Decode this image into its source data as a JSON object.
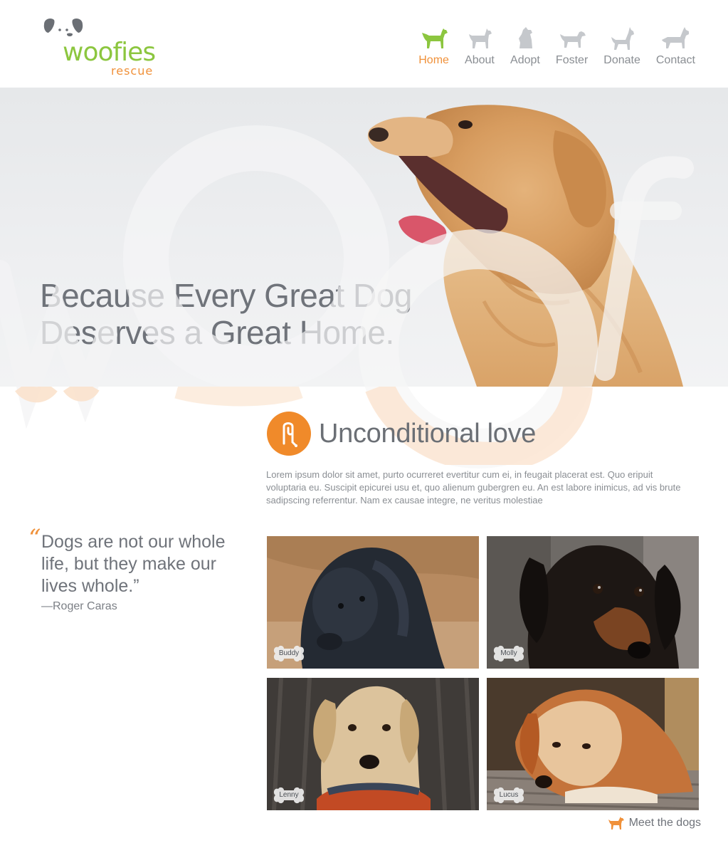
{
  "brand": {
    "name": "woofies",
    "tagline": "rescue",
    "primary_color": "#8cc63f",
    "accent_color": "#f0913a",
    "icon": "dog-face-logo-icon"
  },
  "nav": {
    "items": [
      {
        "label": "Home",
        "icon": "dog-standing-icon",
        "active": true
      },
      {
        "label": "About",
        "icon": "dog-standing-icon",
        "active": false
      },
      {
        "label": "Adopt",
        "icon": "dog-sitting-icon",
        "active": false
      },
      {
        "label": "Foster",
        "icon": "dog-standing-icon",
        "active": false
      },
      {
        "label": "Donate",
        "icon": "dog-standing-icon",
        "active": false
      },
      {
        "label": "Contact",
        "icon": "dog-standing-icon",
        "active": false
      }
    ]
  },
  "hero": {
    "title_line1": "Because Every Great Dog",
    "title_line2": "Deserves a Great Home.",
    "watermark": "woof"
  },
  "section": {
    "icon": "leash-icon",
    "title": "Unconditional love",
    "body": "Lorem ipsum dolor sit amet, purto ocurreret evertitur cum ei, in feugait placerat est. Quo eripuit voluptaria eu. Suscipit epicurei usu et, quo alienum gubergren eu. An est labore inimicus, ad vis brute sadipscing referrentur. Nam ex causae integre, ne veritus molestiae"
  },
  "quote": {
    "mark": "“",
    "text": "Dogs are not our whole life, but they make our lives whole.”",
    "author": "—Roger Caras"
  },
  "dogs": [
    {
      "name": "Buddy"
    },
    {
      "name": "Molly"
    },
    {
      "name": "Lenny"
    },
    {
      "name": "Lucus"
    }
  ],
  "cta": {
    "label": "Meet the dogs",
    "icon": "dog-standing-icon"
  }
}
